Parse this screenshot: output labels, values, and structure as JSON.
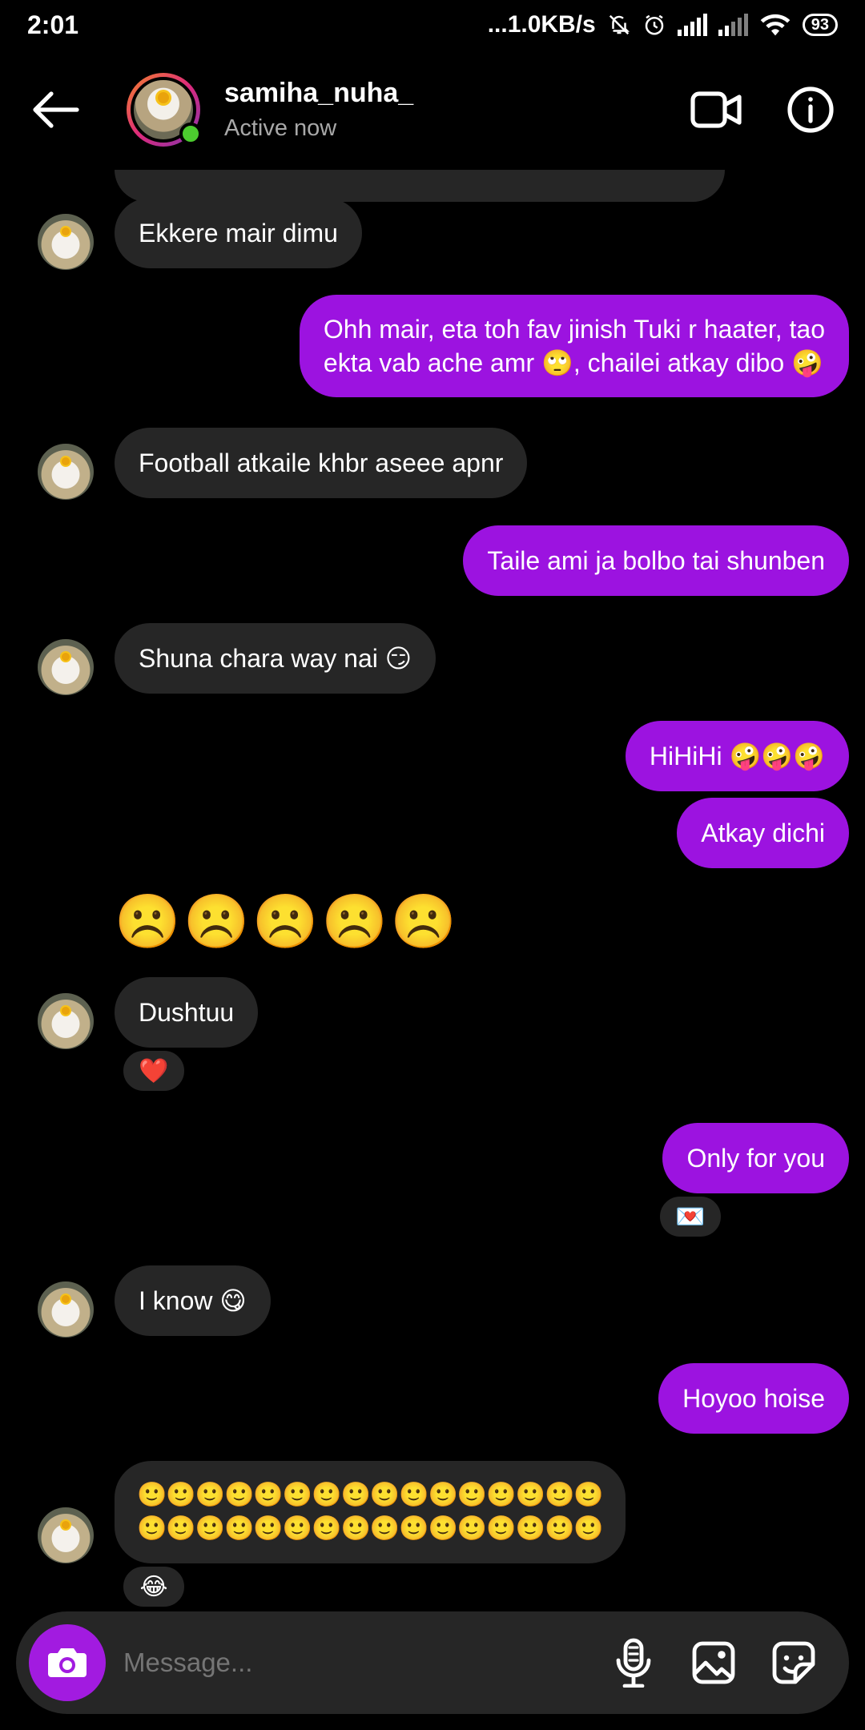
{
  "status_bar": {
    "time": "2:01",
    "speed": "...1.0KB/s",
    "battery": "93"
  },
  "header": {
    "back_icon": "arrow-left-icon",
    "username": "samiha_nuha_",
    "status": "Active now",
    "video_icon": "video-call-icon",
    "info_icon": "info-icon"
  },
  "messages": [
    {
      "dir": "in",
      "text": "Ekkere mair dimu"
    },
    {
      "dir": "out",
      "line1": "Ohh mair, eta toh fav jinish Tuki r haater, tao",
      "line2": "ekta vab ache amr 🙄, chailei atkay dibo 🤪"
    },
    {
      "dir": "in",
      "text": "Football atkaile khbr aseee apnr"
    },
    {
      "dir": "out",
      "text": "Taile ami ja bolbo tai shunben"
    },
    {
      "dir": "in",
      "text": "Shuna chara way nai 😏"
    },
    {
      "dir": "out",
      "text": "HiHiHi 🤪🤪🤪"
    },
    {
      "dir": "out",
      "text": "Atkay dichi"
    },
    {
      "dir": "in",
      "text": "☹️☹️☹️☹️☹️"
    },
    {
      "dir": "in",
      "text": "Dushtuu",
      "reaction": "❤️"
    },
    {
      "dir": "out",
      "text": "Only for you",
      "reaction": "💌"
    },
    {
      "dir": "in",
      "text": "I know 😋"
    },
    {
      "dir": "out",
      "text": "Hoyoo hoise"
    },
    {
      "dir": "in",
      "line1": "🙂🙂🙂🙂🙂🙂🙂🙂🙂🙂🙂🙂🙂🙂🙂🙂",
      "line2": "🙂🙂🙂🙂🙂🙂🙂🙂🙂🙂🙂🙂🙂🙂🙂🙂",
      "reaction": "😂"
    }
  ],
  "composer": {
    "placeholder": "Message...",
    "camera_icon": "camera-icon",
    "mic_icon": "microphone-icon",
    "gallery_icon": "gallery-icon",
    "sticker_icon": "sticker-icon"
  },
  "colors": {
    "outgoing": "#9c13e0",
    "incoming": "#262626",
    "background": "#000000"
  }
}
